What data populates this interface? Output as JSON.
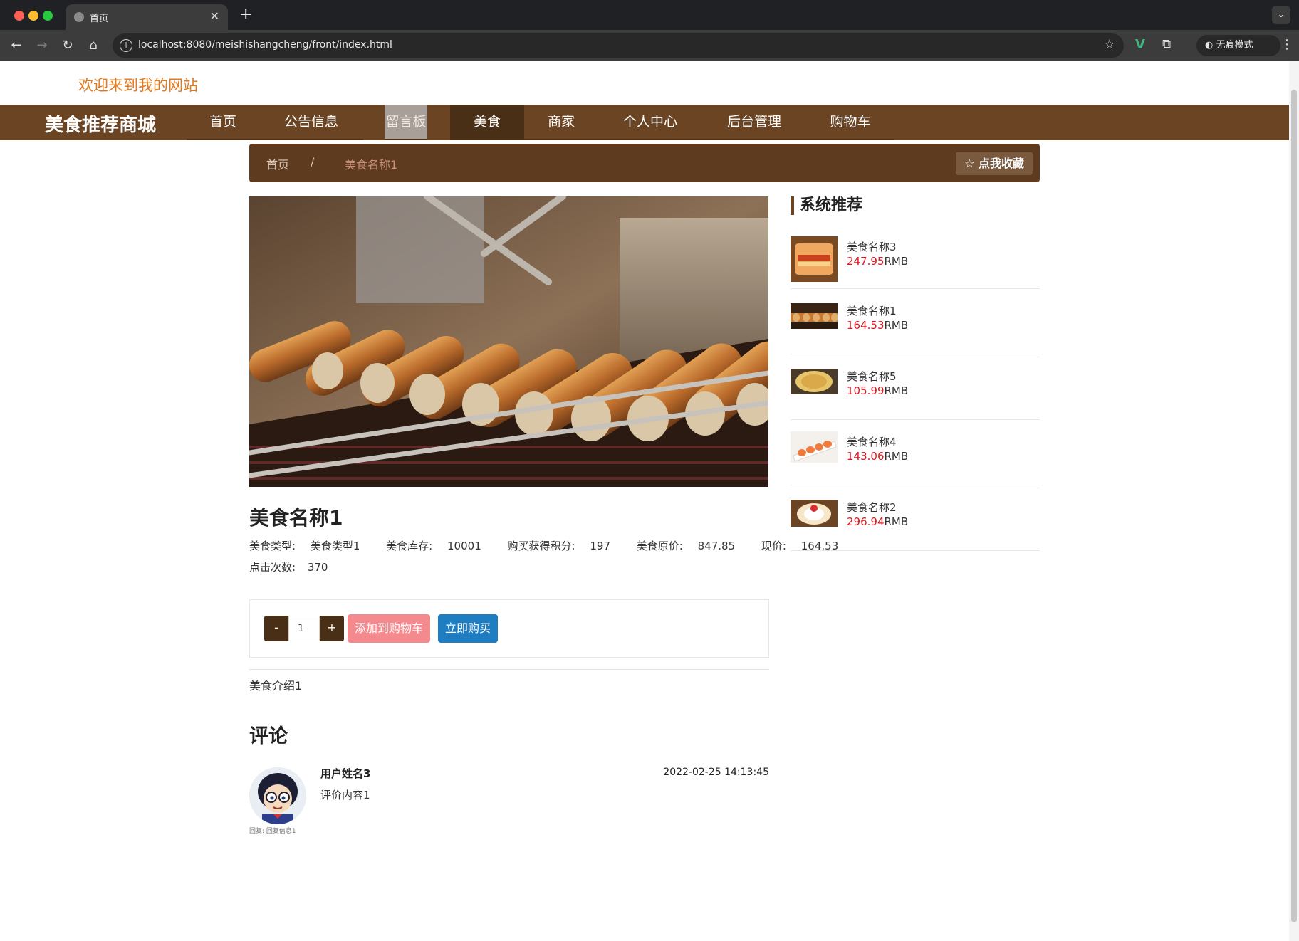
{
  "browser": {
    "tab_title": "首页",
    "url": "localhost:8080/meishishangcheng/front/index.html",
    "incognito_label": "无痕模式"
  },
  "site": {
    "welcome": "欢迎来到我的网站",
    "logo": "美食推荐商城",
    "nav": [
      "首页",
      "公告信息",
      "留言板",
      "美食",
      "商家",
      "个人中心",
      "后台管理",
      "购物车"
    ],
    "active_nav": "美食",
    "hovered_nav": "留言板"
  },
  "breadcrumb": {
    "home": "首页",
    "separator": "/",
    "current": "美食名称1",
    "favorite_label": "点我收藏"
  },
  "product": {
    "name": "美食名称1",
    "fields": [
      {
        "label": "美食类型:",
        "value": "美食类型1"
      },
      {
        "label": "美食库存:",
        "value": "10001"
      },
      {
        "label": "购买获得积分:",
        "value": "197"
      },
      {
        "label": "美食原价:",
        "value": "847.85"
      },
      {
        "label": "现价:",
        "value": "164.53"
      }
    ],
    "clicks_label": "点击次数:",
    "clicks_value": "370",
    "quantity": "1",
    "minus_label": "-",
    "plus_label": "+",
    "add_to_cart": "添加到购物车",
    "buy_now": "立即购买",
    "intro": "美食介绍1"
  },
  "comments": {
    "heading": "评论",
    "items": [
      {
        "user": "用户姓名3",
        "time": "2022-02-25 14:13:45",
        "content": "评价内容1",
        "reply": "回复: 回复信息1"
      }
    ]
  },
  "sidebar": {
    "heading": "系统推荐",
    "currency": "RMB",
    "items": [
      {
        "name": "美食名称3",
        "price": "247.95",
        "thumb": "sandwich"
      },
      {
        "name": "美食名称1",
        "price": "164.53",
        "thumb": "grilled-mushrooms"
      },
      {
        "name": "美食名称5",
        "price": "105.99",
        "thumb": "pancake"
      },
      {
        "name": "美食名称4",
        "price": "143.06",
        "thumb": "sushi"
      },
      {
        "name": "美食名称2",
        "price": "296.94",
        "thumb": "cake-roll"
      }
    ]
  },
  "colors": {
    "nav_bg": "#6b4423",
    "nav_active": "#4a2f17",
    "welcome": "#e07a1f",
    "price": "#e0131b",
    "add_cart": "#f48a8e",
    "buy_now": "#1f7dc2"
  }
}
